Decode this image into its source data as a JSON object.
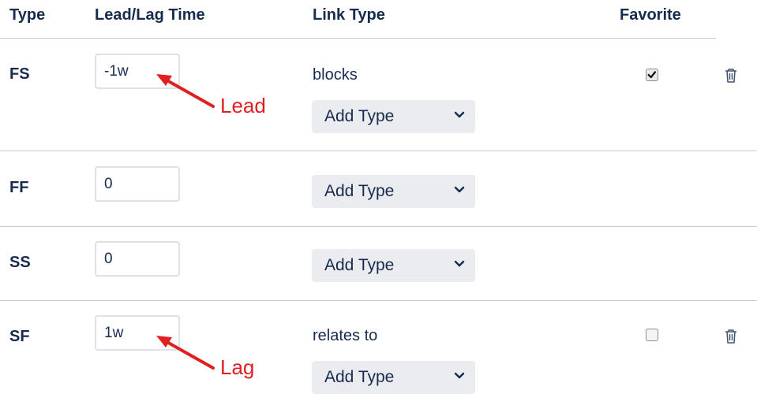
{
  "headers": {
    "type": "Type",
    "lead_lag": "Lead/Lag Time",
    "link_type": "Link Type",
    "favorite": "Favorite"
  },
  "rows": [
    {
      "type": "FS",
      "lead_lag_value": "-1w",
      "link_type": "blocks",
      "select_label": "Add Type",
      "favorite": true
    },
    {
      "type": "FF",
      "lead_lag_value": "0",
      "link_type": "",
      "select_label": "Add Type"
    },
    {
      "type": "SS",
      "lead_lag_value": "0",
      "link_type": "",
      "select_label": "Add Type"
    },
    {
      "type": "SF",
      "lead_lag_value": "1w",
      "link_type": "relates to",
      "select_label": "Add Type",
      "favorite": false
    }
  ],
  "annotations": {
    "lead": "Lead",
    "lag": "Lag"
  },
  "colors": {
    "annotation": "#e02020",
    "text": "#172b4d",
    "select_bg": "#ebecf0",
    "divider": "#c8ccd1"
  },
  "icons": {
    "delete": "trash-icon",
    "dropdown": "chevron-down-icon",
    "checkbox_checked": "checkmark-icon"
  }
}
